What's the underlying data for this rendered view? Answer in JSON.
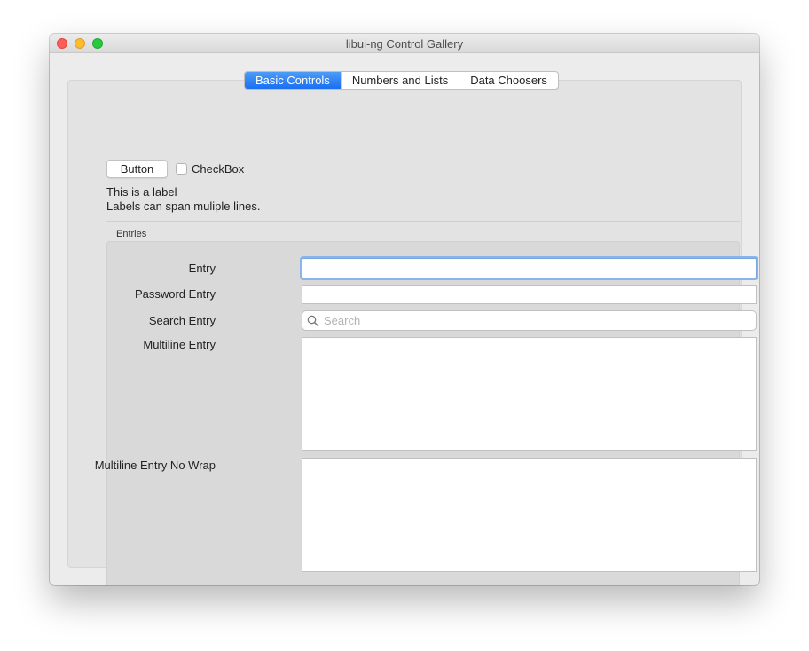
{
  "window": {
    "title": "libui-ng Control Gallery"
  },
  "tabs": [
    {
      "label": "Basic Controls",
      "active": true
    },
    {
      "label": "Numbers and Lists",
      "active": false
    },
    {
      "label": "Data Choosers",
      "active": false
    }
  ],
  "basic": {
    "button_label": "Button",
    "checkbox_label": "CheckBox",
    "checkbox_checked": false,
    "label_line1": "This is a label",
    "label_line2": "Labels can span muliple lines."
  },
  "entries": {
    "group_title": "Entries",
    "entry_label": "Entry",
    "entry_value": "",
    "password_label": "Password Entry",
    "password_value": "",
    "search_label": "Search Entry",
    "search_placeholder": "Search",
    "multiline_label": "Multiline Entry",
    "multiline_value": "",
    "multiline_nowrap_label": "Multiline Entry No Wrap",
    "multiline_nowrap_value": ""
  },
  "colors": {
    "accent": "#1a6ff2",
    "close": "#fc5f57",
    "minimize": "#fdbc2e",
    "maximize": "#28c83f"
  }
}
